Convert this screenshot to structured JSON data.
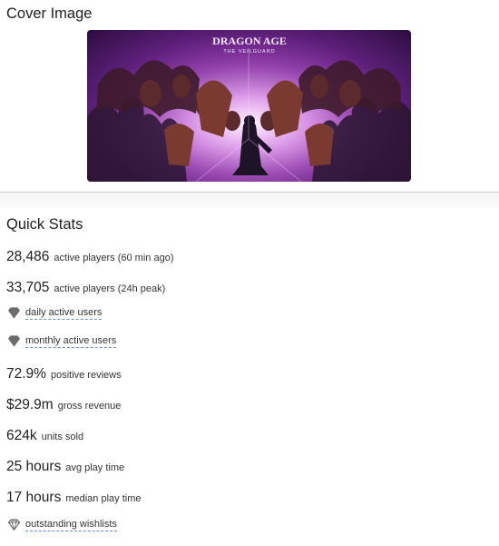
{
  "cover": {
    "title": "Cover Image",
    "logo_line1": "DRAGON AGE",
    "logo_line2": "THE VEILGUARD"
  },
  "stats": {
    "title": "Quick Stats",
    "rows": [
      {
        "value": "28,486",
        "label": "active players (60 min ago)"
      },
      {
        "value": "33,705",
        "label": "active players (24h peak)"
      },
      {
        "link": "daily active users",
        "icon": "gem-filled-icon"
      },
      {
        "link": "monthly active users",
        "icon": "gem-filled-icon"
      },
      {
        "value": "72.9%",
        "label": "positive reviews"
      },
      {
        "value": "$29.9m",
        "label": "gross revenue"
      },
      {
        "value": "624k",
        "label": "units sold"
      },
      {
        "value": "25 hours",
        "label": "avg play time"
      },
      {
        "value": "17 hours",
        "label": "median play time"
      },
      {
        "link": "outstanding wishlists",
        "icon": "gem-outline-icon"
      }
    ]
  },
  "colors": {
    "text": "#212121",
    "link_underline": "#6a8fd0",
    "gem": "#6b6b6b",
    "cover_glow": "#d28be0",
    "cover_dark": "#2c0d3f"
  }
}
